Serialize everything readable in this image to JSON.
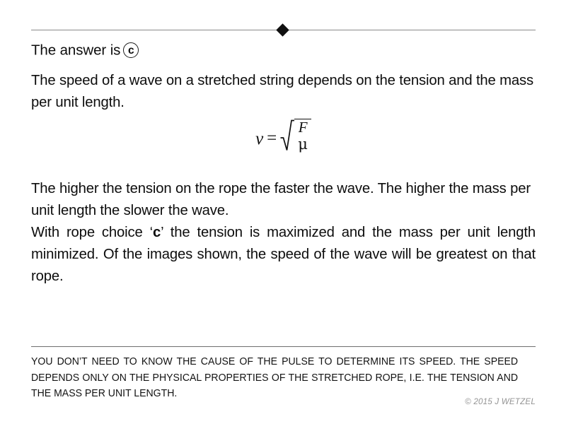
{
  "slide": {
    "title_divider": {
      "icon": "diamond-bullet",
      "rule_color": "#8a8a8a"
    },
    "answer": {
      "label": "The answer is",
      "choice": "c"
    },
    "paragraphs": [
      "The speed of a wave on a stretched string depends on the tension and the mass per unit length.",
      "The higher the tension on the rope the faster the wave.  The higher the mass per unit length the slower the wave."
    ],
    "justified_paragraph": {
      "before": "With rope choice ‘",
      "emphasis": "c",
      "after": "’ the tension is maximized and the mass per unit length minimized.  Of the images shown, the speed of the wave will be greatest on that rope."
    },
    "formula": {
      "variable": "v",
      "equals": "=",
      "radical_symbol": "√",
      "numerator": "F",
      "denominator": "μ",
      "plain_text": "v = √(F/μ)"
    },
    "footer": {
      "note": "YOU DON’T NEED TO KNOW THE CAUSE OF THE PULSE TO DETERMINE ITS SPEED.  THE SPEED DEPENDS ONLY ON THE PHYSICAL PROPERTIES OF THE STRETCHED ROPE, I.E. THE TENSION AND THE MASS PER UNIT LENGTH.",
      "copyright": "© 2015 J WETZEL",
      "rule_color": "#6e6e6e"
    }
  }
}
